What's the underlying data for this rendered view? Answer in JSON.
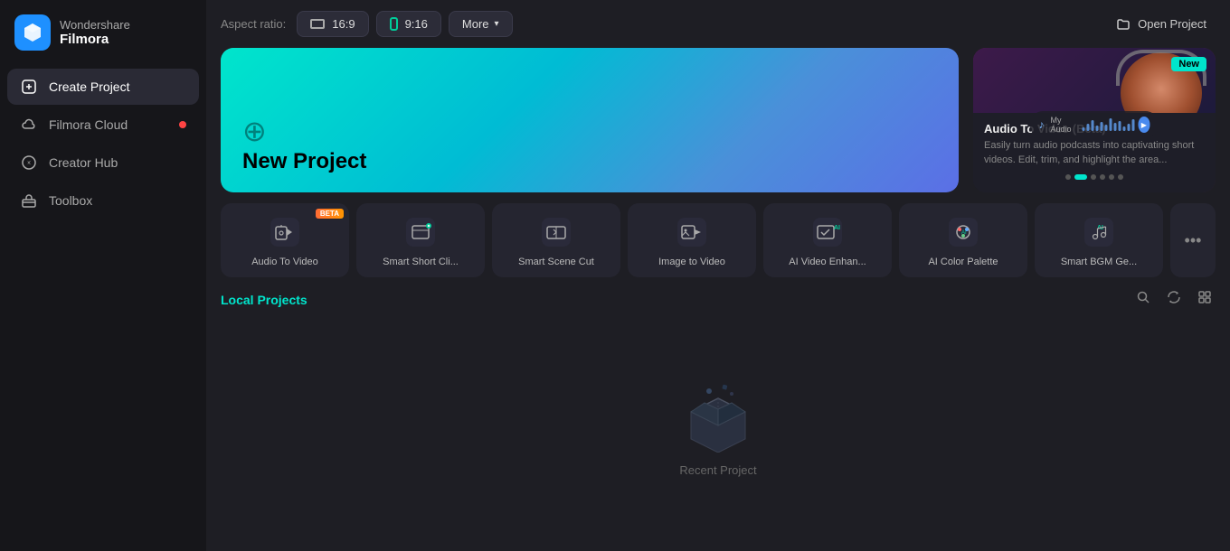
{
  "app": {
    "brand": "Wondershare",
    "product": "Filmora"
  },
  "sidebar": {
    "items": [
      {
        "id": "create-project",
        "label": "Create Project",
        "icon": "plus-square",
        "active": true
      },
      {
        "id": "filmora-cloud",
        "label": "Filmora Cloud",
        "icon": "cloud",
        "active": false,
        "badge": true
      },
      {
        "id": "creator-hub",
        "label": "Creator Hub",
        "icon": "compass",
        "active": false
      },
      {
        "id": "toolbox",
        "label": "Toolbox",
        "icon": "toolbox",
        "active": false
      }
    ]
  },
  "topbar": {
    "aspect_label": "Aspect ratio:",
    "ratio_16_9": "16:9",
    "ratio_9_16": "9:16",
    "more_label": "More",
    "open_project_label": "Open Project"
  },
  "new_project": {
    "title": "New Project",
    "icon": "+"
  },
  "feature_card": {
    "badge": "New",
    "title": "Audio To Video (Beta)",
    "description": "Easily turn audio podcasts into captivating short videos. Edit, trim, and highlight the area...",
    "dots": [
      false,
      true,
      false,
      false,
      false,
      false
    ]
  },
  "ai_tools": [
    {
      "id": "audio-to-video",
      "name": "Audio To Video",
      "icon": "🎵",
      "beta": true
    },
    {
      "id": "smart-short-clip",
      "name": "Smart Short Cli...",
      "icon": "✂",
      "beta": false
    },
    {
      "id": "smart-scene-cut",
      "name": "Smart Scene Cut",
      "icon": "🎬",
      "beta": false
    },
    {
      "id": "image-to-video",
      "name": "Image to Video",
      "icon": "🖼",
      "beta": false
    },
    {
      "id": "ai-video-enhance",
      "name": "AI Video Enhan...",
      "icon": "✨",
      "beta": false
    },
    {
      "id": "ai-color-palette",
      "name": "AI Color Palette",
      "icon": "🎨",
      "beta": false
    },
    {
      "id": "smart-bgm",
      "name": "Smart BGM Ge...",
      "icon": "🎶",
      "beta": false
    }
  ],
  "local_projects": {
    "title": "Local Projects",
    "empty_text": "Recent Project",
    "actions": [
      "search",
      "refresh",
      "grid-view"
    ]
  }
}
